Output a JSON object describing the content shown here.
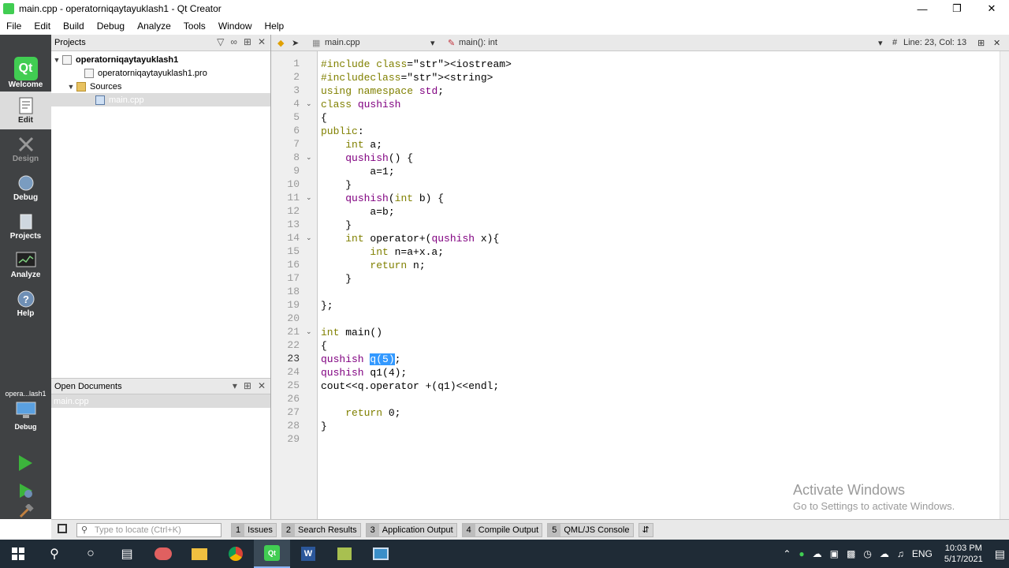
{
  "window": {
    "title": "main.cpp - operatorniqaytayuklash1 - Qt Creator"
  },
  "menu": [
    "File",
    "Edit",
    "Build",
    "Debug",
    "Analyze",
    "Tools",
    "Window",
    "Help"
  ],
  "modes": [
    {
      "label": "Welcome",
      "icon": "qt-logo-icon"
    },
    {
      "label": "Edit",
      "icon": "edit-document-icon"
    },
    {
      "label": "Design",
      "icon": "design-tools-icon"
    },
    {
      "label": "Debug",
      "icon": "debug-bug-icon"
    },
    {
      "label": "Projects",
      "icon": "projects-icon"
    },
    {
      "label": "Analyze",
      "icon": "analyze-monitor-icon"
    },
    {
      "label": "Help",
      "icon": "help-icon"
    }
  ],
  "target_selector": {
    "project": "opera...lash1",
    "config": "Debug"
  },
  "projects_pane": {
    "title": "Projects",
    "tree": [
      {
        "label": "operatorniqaytayuklash1",
        "bold": true
      },
      {
        "label": "operatorniqaytayuklash1.pro"
      },
      {
        "label": "Sources"
      },
      {
        "label": "main.cpp",
        "selected": true
      }
    ]
  },
  "open_documents": {
    "title": "Open Documents",
    "items": [
      "main.cpp"
    ]
  },
  "editor_toolbar": {
    "file": "main.cpp",
    "symbol": "main(): int",
    "hash": "#",
    "position": "Line: 23, Col: 13"
  },
  "code": {
    "current_line": 23,
    "lines": [
      "#include <iostream>",
      "#include<string>",
      "using namespace std;",
      "class qushish",
      "{",
      "public:",
      "    int a;",
      "    qushish() {",
      "        a=1;",
      "    }",
      "    qushish(int b) {",
      "        a=b;",
      "    }",
      "    int operator+(qushish x){",
      "        int n=a+x.a;",
      "        return n;",
      "    }",
      "",
      "};",
      "",
      "int main()",
      "{",
      "qushish q(5);",
      "qushish q1(4);",
      "cout<<q.operator +(q1)<<endl;",
      "",
      "    return 0;",
      "}",
      ""
    ]
  },
  "watermark": {
    "line1": "Activate Windows",
    "line2": "Go to Settings to activate Windows."
  },
  "output_bar": {
    "locator_placeholder": "Type to locate (Ctrl+K)",
    "panes": [
      {
        "n": "1",
        "label": "Issues"
      },
      {
        "n": "2",
        "label": "Search Results"
      },
      {
        "n": "3",
        "label": "Application Output"
      },
      {
        "n": "4",
        "label": "Compile Output"
      },
      {
        "n": "5",
        "label": "QML/JS Console"
      }
    ]
  },
  "taskbar": {
    "language": "ENG",
    "time": "10:03 PM",
    "date": "5/17/2021"
  }
}
